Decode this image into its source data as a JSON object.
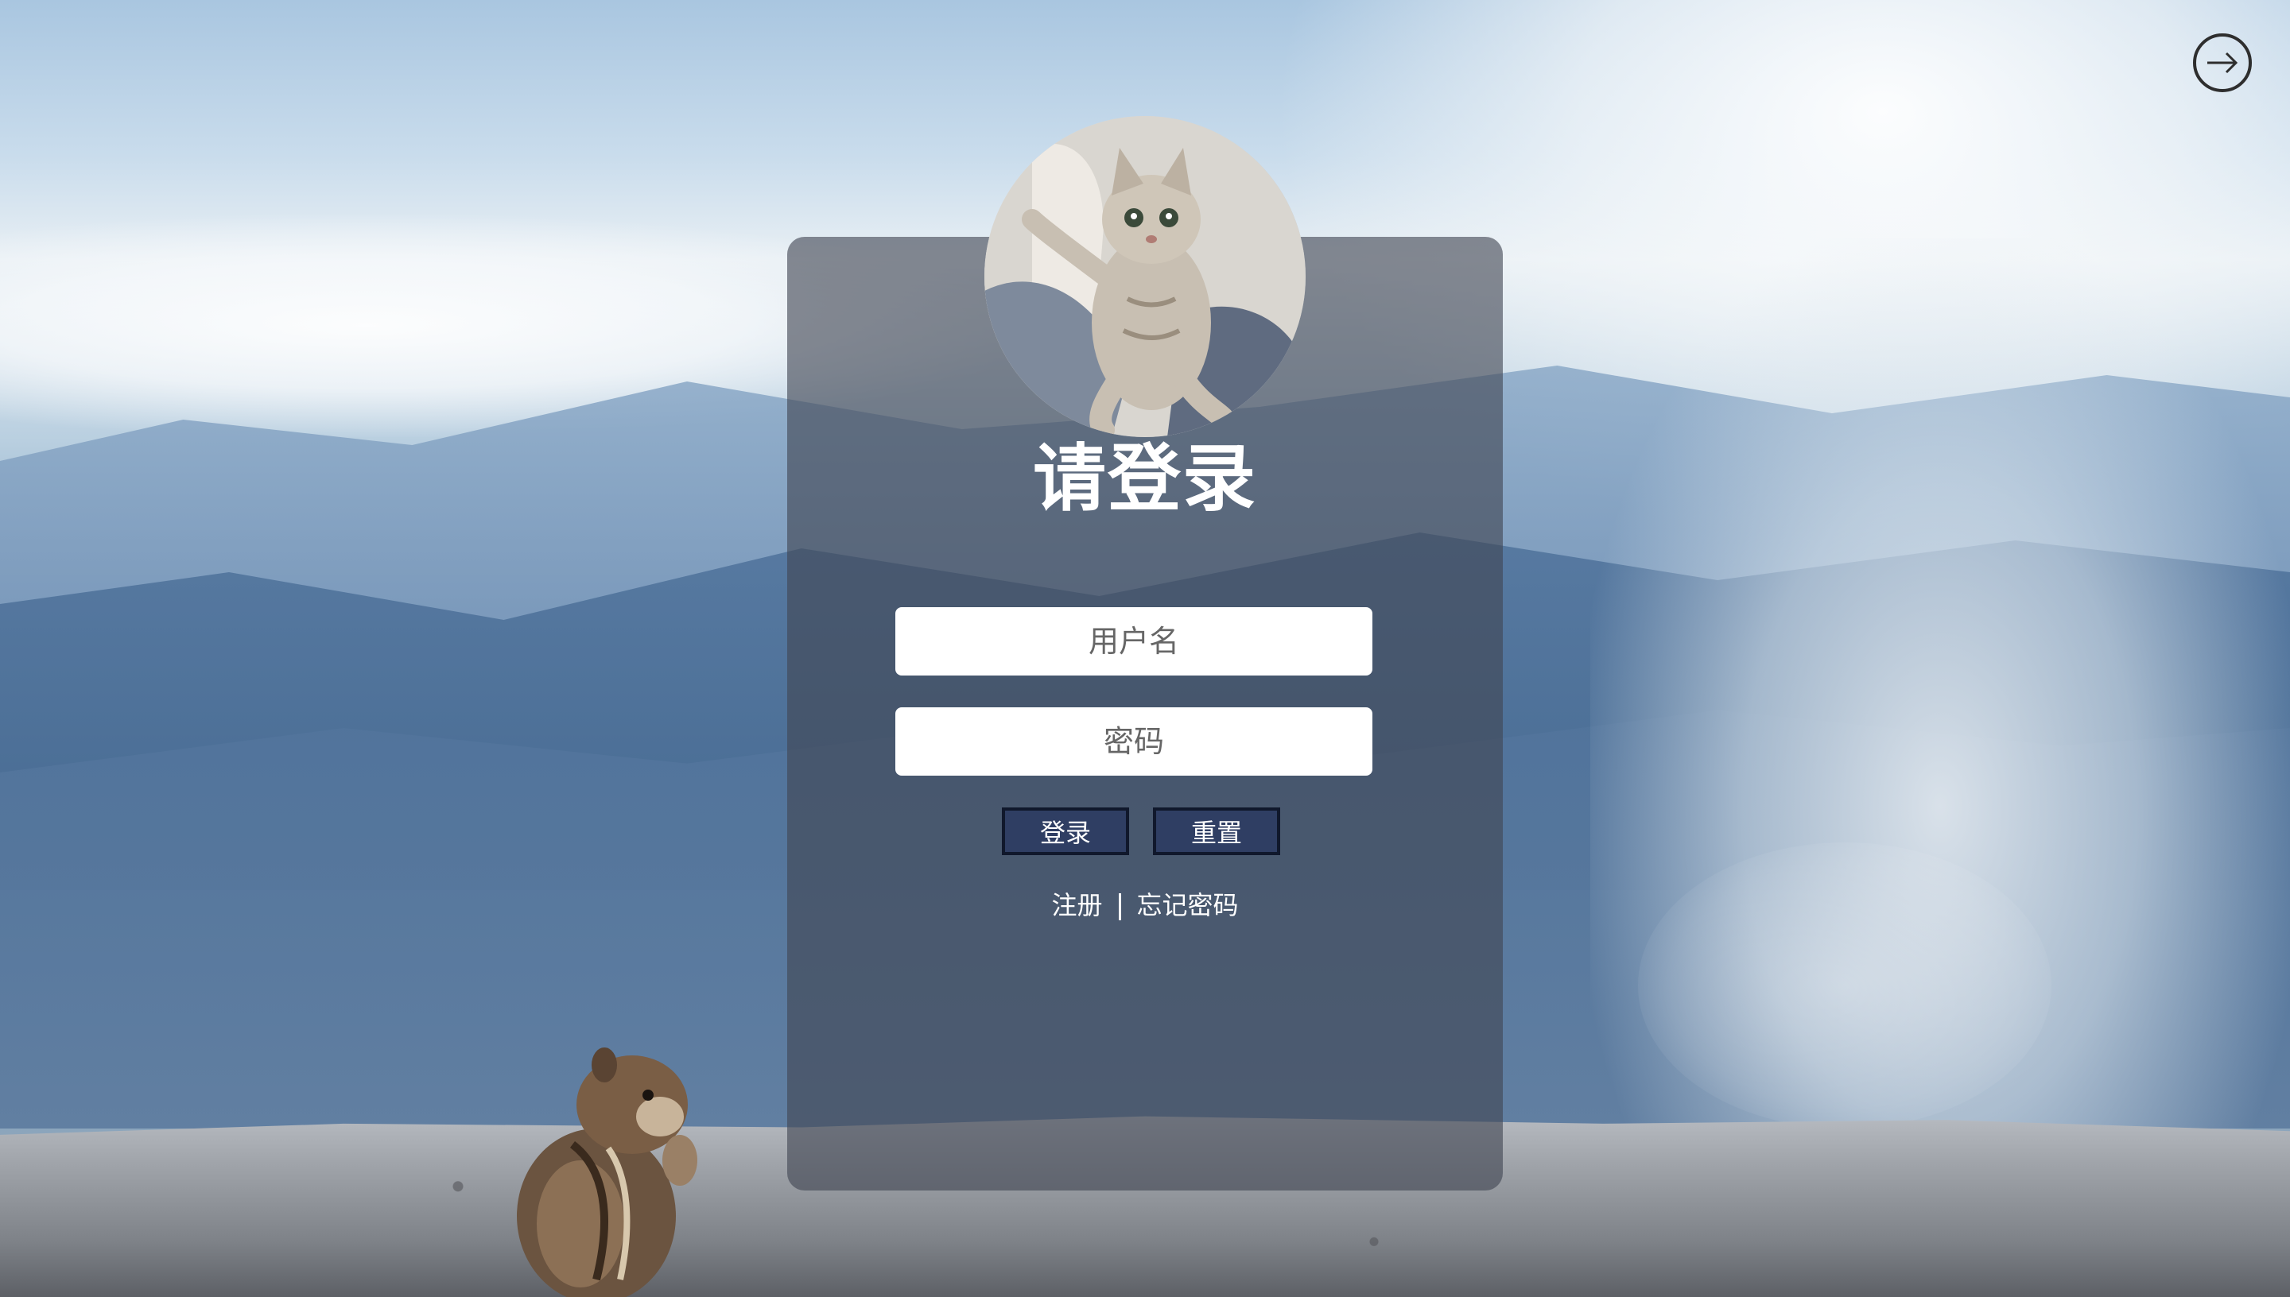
{
  "login": {
    "title": "请登录",
    "username_placeholder": "用户名",
    "password_placeholder": "密码",
    "login_button": "登录",
    "reset_button": "重置",
    "register_link": "注册",
    "forgot_link": "忘记密码"
  },
  "icons": {
    "logout": "logout-icon",
    "avatar": "cat-avatar"
  },
  "colors": {
    "button_bg": "#2f3e63",
    "button_border": "#10182c",
    "panel_bg": "rgba(64,70,82,0.62)",
    "title_text": "#ffffff"
  }
}
